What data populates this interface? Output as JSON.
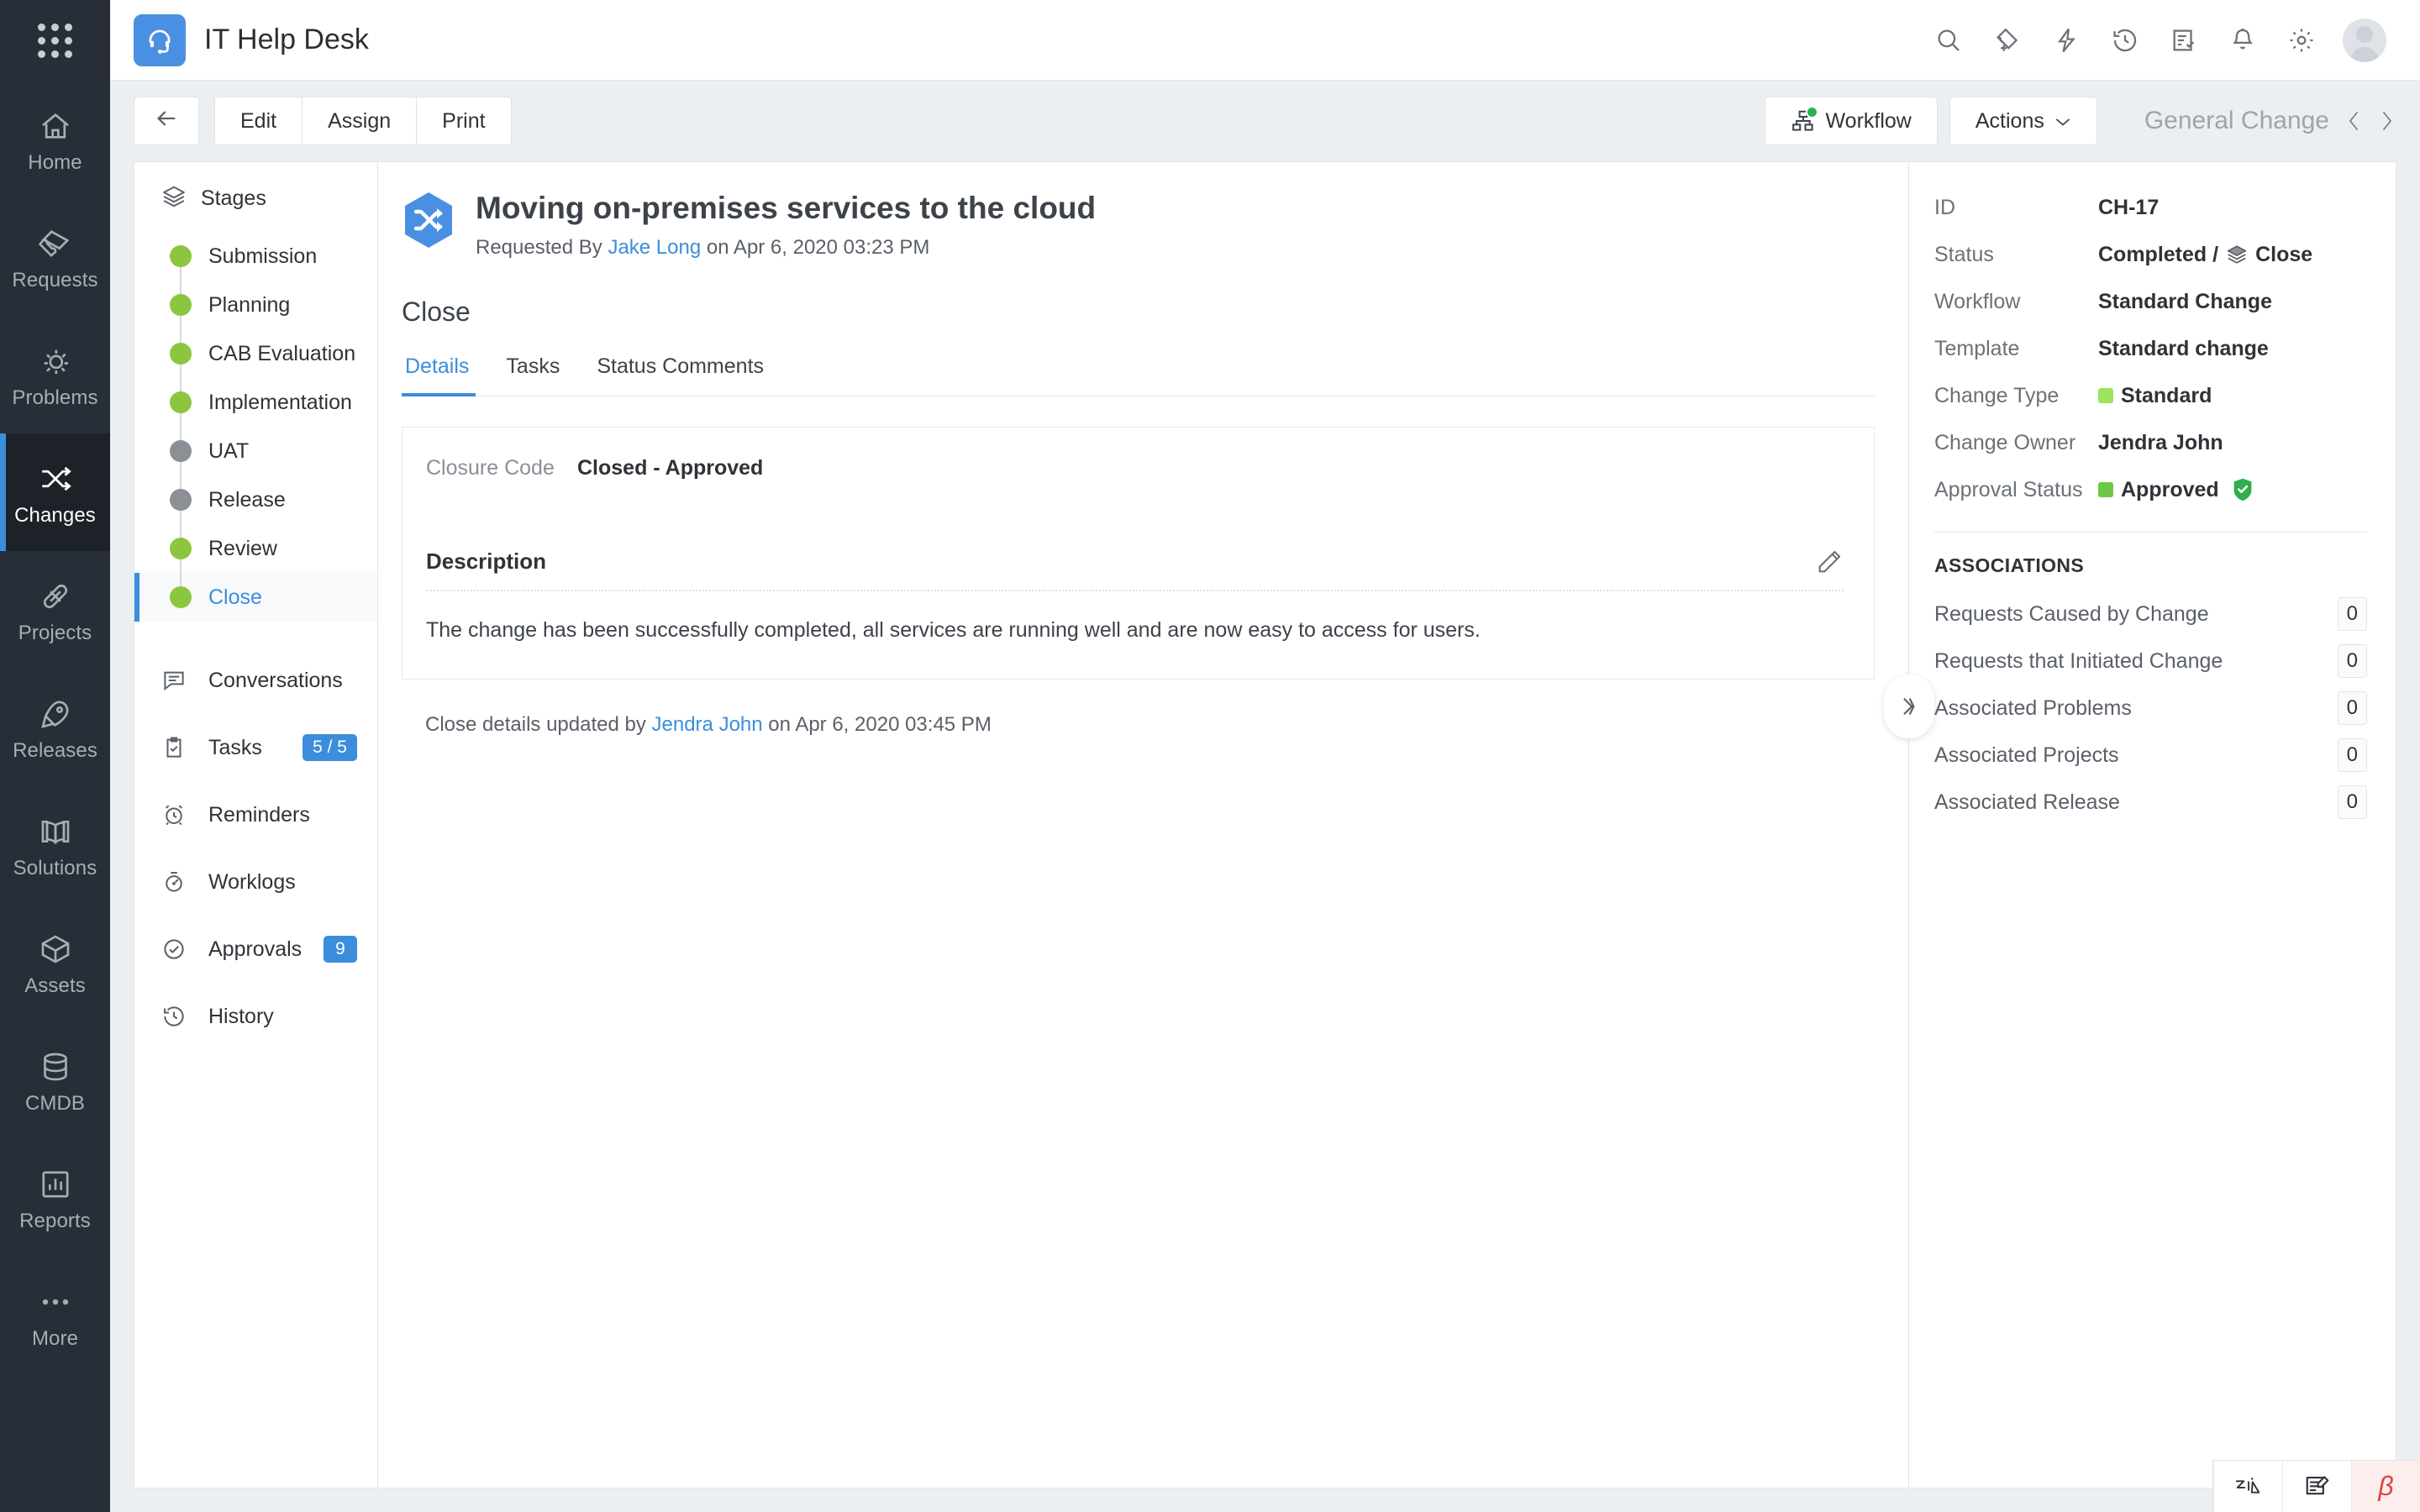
{
  "app": {
    "title": "IT Help Desk",
    "logo_icon": "headset-icon",
    "grid_icon": "app-switcher-grid-icon"
  },
  "rail": {
    "items": [
      {
        "label": "Home",
        "icon": "home-icon",
        "active": false
      },
      {
        "label": "Requests",
        "icon": "ticket-icon",
        "active": false
      },
      {
        "label": "Problems",
        "icon": "bug-icon",
        "active": false
      },
      {
        "label": "Changes",
        "icon": "shuffle-icon",
        "active": true
      },
      {
        "label": "Projects",
        "icon": "bandage-icon",
        "active": false
      },
      {
        "label": "Releases",
        "icon": "rocket-icon",
        "active": false
      },
      {
        "label": "Solutions",
        "icon": "book-icon",
        "active": false
      },
      {
        "label": "Assets",
        "icon": "cube-icon",
        "active": false
      },
      {
        "label": "CMDB",
        "icon": "database-icon",
        "active": false
      },
      {
        "label": "Reports",
        "icon": "chart-icon",
        "active": false
      },
      {
        "label": "More",
        "icon": "ellipsis-icon",
        "active": false
      }
    ]
  },
  "header_icons": [
    {
      "name": "search-icon"
    },
    {
      "name": "add-ticket-icon"
    },
    {
      "name": "quick-action-bolt-icon"
    },
    {
      "name": "history-clock-icon"
    },
    {
      "name": "task-list-icon"
    },
    {
      "name": "notification-bell-icon"
    },
    {
      "name": "settings-gear-icon"
    }
  ],
  "toolbar": {
    "back_icon": "back-arrow-icon",
    "edit_label": "Edit",
    "assign_label": "Assign",
    "print_label": "Print",
    "workflow_label": "Workflow",
    "workflow_icon": "workflow-tree-icon",
    "actions_label": "Actions",
    "actions_caret": "⌄",
    "record_type": "General Change",
    "prev_icon": "chevron-left-icon",
    "next_icon": "chevron-right-icon"
  },
  "stages_panel": {
    "header": "Stages",
    "header_icon": "layers-icon",
    "stages": [
      {
        "label": "Submission",
        "state": "done"
      },
      {
        "label": "Planning",
        "state": "done"
      },
      {
        "label": "CAB Evaluation",
        "state": "done"
      },
      {
        "label": "Implementation",
        "state": "done"
      },
      {
        "label": "UAT",
        "state": "skipped"
      },
      {
        "label": "Release",
        "state": "skipped"
      },
      {
        "label": "Review",
        "state": "done"
      },
      {
        "label": "Close",
        "state": "current"
      }
    ],
    "menu": [
      {
        "label": "Conversations",
        "icon": "conversation-icon",
        "badge": null
      },
      {
        "label": "Tasks",
        "icon": "clipboard-check-icon",
        "badge": "5 / 5"
      },
      {
        "label": "Reminders",
        "icon": "alarm-clock-icon",
        "badge": null
      },
      {
        "label": "Worklogs",
        "icon": "stopwatch-icon",
        "badge": null
      },
      {
        "label": "Approvals",
        "icon": "check-circle-icon",
        "badge": "9"
      },
      {
        "label": "History",
        "icon": "history-icon",
        "badge": null
      }
    ]
  },
  "record": {
    "icon": "change-hexagon-icon",
    "title": "Moving on-premises services to the cloud",
    "requested_by_prefix": "Requested By",
    "requested_by": "Jake Long",
    "requested_on": "on Apr 6, 2020 03:23 PM",
    "stage_title": "Close",
    "tabs": [
      {
        "label": "Details",
        "active": true
      },
      {
        "label": "Tasks",
        "active": false
      },
      {
        "label": "Status Comments",
        "active": false
      }
    ],
    "closure_code_label": "Closure Code",
    "closure_code_value": "Closed - Approved",
    "description_label": "Description",
    "description_edit_icon": "pencil-icon",
    "description_body": "The change has been successfully completed, all services are running well and are now easy to access for users.",
    "updated_prefix": "Close details updated by",
    "updated_by": "Jendra John",
    "updated_on": "on Apr 6, 2020 03:45 PM"
  },
  "properties": [
    {
      "label": "ID",
      "value": "CH-17",
      "swatch": null,
      "icon": null
    },
    {
      "label": "Status",
      "value": "Completed /",
      "value2": "Close",
      "swatch": null,
      "icon": "layers-icon"
    },
    {
      "label": "Workflow",
      "value": "Standard Change",
      "swatch": null,
      "icon": null
    },
    {
      "label": "Template",
      "value": "Standard change",
      "swatch": null,
      "icon": null
    },
    {
      "label": "Change Type",
      "value": "Standard",
      "swatch": "#9be45b",
      "icon": null
    },
    {
      "label": "Change Owner",
      "value": "Jendra John",
      "swatch": null,
      "icon": null
    },
    {
      "label": "Approval Status",
      "value": "Approved",
      "swatch": "#6ec845",
      "icon": "shield-check-icon"
    }
  ],
  "associations": {
    "title": "ASSOCIATIONS",
    "rows": [
      {
        "label": "Requests Caused by Change",
        "count": "0"
      },
      {
        "label": "Requests that Initiated Change",
        "count": "0"
      },
      {
        "label": "Associated Problems",
        "count": "0"
      },
      {
        "label": "Associated Projects",
        "count": "0"
      },
      {
        "label": "Associated Release",
        "count": "0"
      }
    ]
  },
  "side_panel": {
    "collapse_icon": "chevron-right-double-icon"
  },
  "bottom_bar": [
    {
      "name": "zia-assistant-icon",
      "label": ""
    },
    {
      "name": "feedback-edit-icon",
      "label": ""
    },
    {
      "name": "beta-badge",
      "label": "β"
    }
  ],
  "colors": {
    "accent": "#3c8ddc",
    "rail_bg": "#272e38",
    "stage_done": "#8cc63f",
    "stage_skipped": "#8b9096",
    "approved": "#6ec845"
  }
}
